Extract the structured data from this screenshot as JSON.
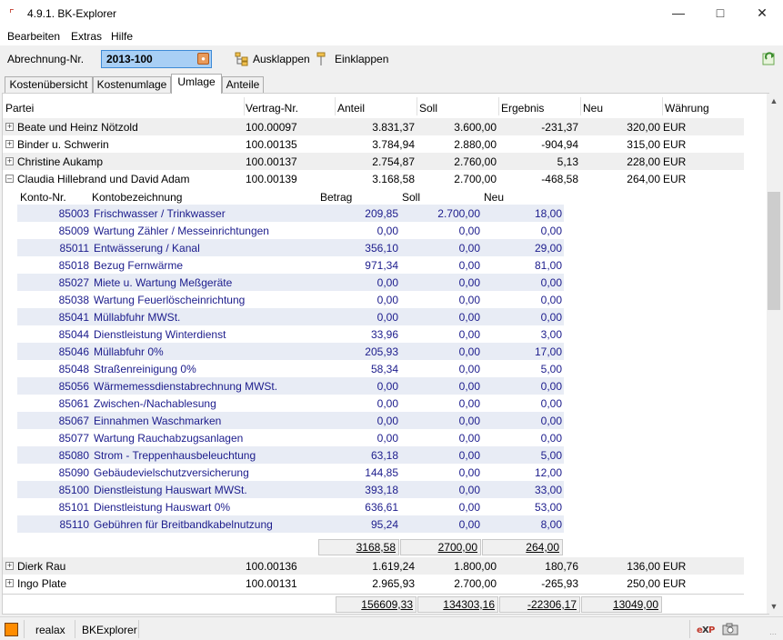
{
  "window": {
    "title": "4.9.1. BK-Explorer"
  },
  "menu": [
    "Bearbeiten",
    "Extras",
    "Hilfe"
  ],
  "toolbar": {
    "abrechnung_label": "Abrechnung-Nr.",
    "abrechnung_value": "2013-100",
    "ausklappen_label": "Ausklappen",
    "einklappen_label": "Einklappen"
  },
  "tabs": [
    "Kostenübersicht",
    "Kostenumlage",
    "Umlage",
    "Anteile"
  ],
  "active_tab": "Umlage",
  "table": {
    "columns": [
      "Partei",
      "Vertrag-Nr.",
      "Anteil",
      "Soll",
      "Ergebnis",
      "Neu",
      "Währung"
    ],
    "rows": [
      {
        "partei": "Beate und Heinz Nötzold",
        "vertrag": "100.00097",
        "anteil": "3.831,37",
        "soll": "3.600,00",
        "ergebnis": "-231,37",
        "neu": "320,00",
        "waehrung": "EUR"
      },
      {
        "partei": "Binder u. Schwerin",
        "vertrag": "100.00135",
        "anteil": "3.784,94",
        "soll": "2.880,00",
        "ergebnis": "-904,94",
        "neu": "315,00",
        "waehrung": "EUR"
      },
      {
        "partei": "Christine Aukamp",
        "vertrag": "100.00137",
        "anteil": "2.754,87",
        "soll": "2.760,00",
        "ergebnis": "5,13",
        "neu": "228,00",
        "waehrung": "EUR"
      },
      {
        "partei": "Claudia Hillebrand und David Adam",
        "vertrag": "100.00139",
        "anteil": "3.168,58",
        "soll": "2.700,00",
        "ergebnis": "-468,58",
        "neu": "264,00",
        "waehrung": "EUR"
      },
      {
        "partei": "Dierk Rau",
        "vertrag": "100.00136",
        "anteil": "1.619,24",
        "soll": "1.800,00",
        "ergebnis": "180,76",
        "neu": "136,00",
        "waehrung": "EUR"
      },
      {
        "partei": "Ingo Plate",
        "vertrag": "100.00131",
        "anteil": "2.965,93",
        "soll": "2.700,00",
        "ergebnis": "-265,93",
        "neu": "250,00",
        "waehrung": "EUR"
      }
    ],
    "totals": {
      "anteil": "156609,33",
      "soll": "134303,16",
      "ergebnis": "-22306,17",
      "neu": "13049,00"
    }
  },
  "detail": {
    "columns": [
      "Konto-Nr.",
      "Kontobezeichnung",
      "Betrag",
      "Soll",
      "Neu"
    ],
    "rows": [
      {
        "konto": "85003",
        "bez": "Frischwasser / Trinkwasser",
        "betrag": "209,85",
        "soll": "2.700,00",
        "neu": "18,00"
      },
      {
        "konto": "85009",
        "bez": "Wartung Zähler / Messeinrichtungen",
        "betrag": "0,00",
        "soll": "0,00",
        "neu": "0,00"
      },
      {
        "konto": "85011",
        "bez": "Entwässerung / Kanal",
        "betrag": "356,10",
        "soll": "0,00",
        "neu": "29,00"
      },
      {
        "konto": "85018",
        "bez": "Bezug Fernwärme",
        "betrag": "971,34",
        "soll": "0,00",
        "neu": "81,00"
      },
      {
        "konto": "85027",
        "bez": "Miete u. Wartung Meßgeräte",
        "betrag": "0,00",
        "soll": "0,00",
        "neu": "0,00"
      },
      {
        "konto": "85038",
        "bez": "Wartung Feuerlöscheinrichtung",
        "betrag": "0,00",
        "soll": "0,00",
        "neu": "0,00"
      },
      {
        "konto": "85041",
        "bez": "Müllabfuhr MWSt.",
        "betrag": "0,00",
        "soll": "0,00",
        "neu": "0,00"
      },
      {
        "konto": "85044",
        "bez": "Dienstleistung Winterdienst",
        "betrag": "33,96",
        "soll": "0,00",
        "neu": "3,00"
      },
      {
        "konto": "85046",
        "bez": "Müllabfuhr 0%",
        "betrag": "205,93",
        "soll": "0,00",
        "neu": "17,00"
      },
      {
        "konto": "85048",
        "bez": "Straßenreinigung 0%",
        "betrag": "58,34",
        "soll": "0,00",
        "neu": "5,00"
      },
      {
        "konto": "85056",
        "bez": "Wärmemessdienstabrechnung MWSt.",
        "betrag": "0,00",
        "soll": "0,00",
        "neu": "0,00"
      },
      {
        "konto": "85061",
        "bez": "Zwischen-/Nachablesung",
        "betrag": "0,00",
        "soll": "0,00",
        "neu": "0,00"
      },
      {
        "konto": "85067",
        "bez": "Einnahmen Waschmarken",
        "betrag": "0,00",
        "soll": "0,00",
        "neu": "0,00"
      },
      {
        "konto": "85077",
        "bez": "Wartung Rauchabzugsanlagen",
        "betrag": "0,00",
        "soll": "0,00",
        "neu": "0,00"
      },
      {
        "konto": "85080",
        "bez": "Strom - Treppenhausbeleuchtung",
        "betrag": "63,18",
        "soll": "0,00",
        "neu": "5,00"
      },
      {
        "konto": "85090",
        "bez": "Gebäudevielschutzversicherung",
        "betrag": "144,85",
        "soll": "0,00",
        "neu": "12,00"
      },
      {
        "konto": "85100",
        "bez": "Dienstleistung Hauswart MWSt.",
        "betrag": "393,18",
        "soll": "0,00",
        "neu": "33,00"
      },
      {
        "konto": "85101",
        "bez": "Dienstleistung Hauswart 0%",
        "betrag": "636,61",
        "soll": "0,00",
        "neu": "53,00"
      },
      {
        "konto": "85110",
        "bez": "Gebühren für Breitbandkabelnutzung",
        "betrag": "95,24",
        "soll": "0,00",
        "neu": "8,00"
      }
    ],
    "totals": {
      "betrag": "3168,58",
      "soll": "2700,00",
      "neu": "264,00"
    }
  },
  "statusbar": {
    "user": "realax",
    "app": "BKExplorer"
  },
  "colors": {
    "accent_blue": "#1c1c8c",
    "status_orange": "#ff8c00",
    "input_bg": "#a8cff5"
  }
}
